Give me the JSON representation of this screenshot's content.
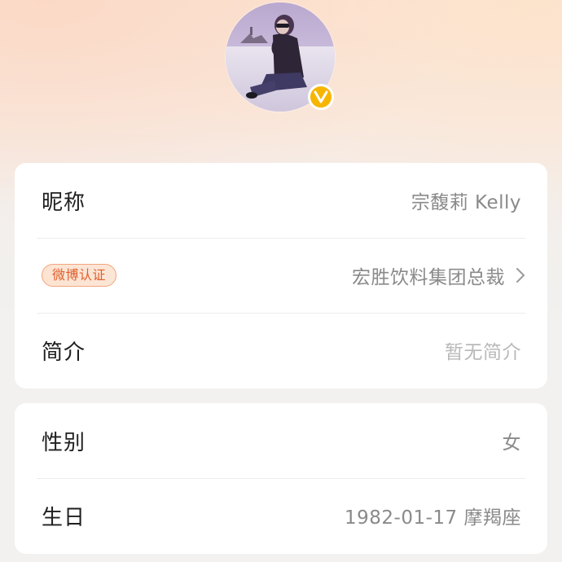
{
  "profile": {
    "avatar_icon": "user-avatar-photo",
    "badge_icon": "verified-v-icon",
    "badge_color": "#f7b500",
    "badge_letter": "V"
  },
  "basic_info": {
    "nickname": {
      "label": "昵称",
      "value": "宗馥莉 Kelly"
    },
    "verification": {
      "badge": "微博认证",
      "value": "宏胜饮料集团总裁",
      "icon": "chevron-right-icon"
    },
    "bio": {
      "label": "简介",
      "value": "暂无简介"
    }
  },
  "personal_info": {
    "gender": {
      "label": "性别",
      "value": "女"
    },
    "birthday": {
      "label": "生日",
      "value": "1982-01-17 摩羯座"
    }
  },
  "colors": {
    "accent": "#e05f2b",
    "badge_gold": "#f7b500",
    "label_text": "#1f1f1f",
    "value_text": "#8a8a8a",
    "placeholder_text": "#b9b9b9"
  }
}
